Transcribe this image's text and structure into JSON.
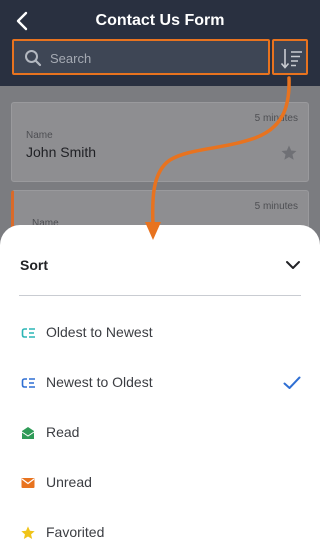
{
  "header": {
    "title": "Contact Us Form",
    "back_icon": "chevron-left-icon",
    "search": {
      "placeholder": "Search",
      "value": ""
    },
    "sort_icon": "sort-descending-list-icon"
  },
  "list": {
    "items": [
      {
        "label": "Name",
        "name": "John Smith",
        "time": "5 minutes",
        "favorite": false
      },
      {
        "label": "Name",
        "name": "",
        "time": "5 minutes",
        "unread": true
      }
    ]
  },
  "sort_sheet": {
    "title": "Sort",
    "options": [
      {
        "label": "Oldest to Newest",
        "icon": "sort-list-icon",
        "color": "#2bb5b5",
        "selected": false
      },
      {
        "label": "Newest to Oldest",
        "icon": "sort-list-icon",
        "color": "#2f6fd3",
        "selected": true
      },
      {
        "label": "Read",
        "icon": "envelope-open-icon",
        "color": "#2e9b57",
        "selected": false
      },
      {
        "label": "Unread",
        "icon": "envelope-icon",
        "color": "#e8731f",
        "selected": false
      },
      {
        "label": "Favorited",
        "icon": "star-icon",
        "color": "#f0c419",
        "selected": false
      }
    ]
  },
  "colors": {
    "header_bg": "#293040",
    "accent_orange": "#e8731f",
    "check_blue": "#2f6fd3"
  }
}
